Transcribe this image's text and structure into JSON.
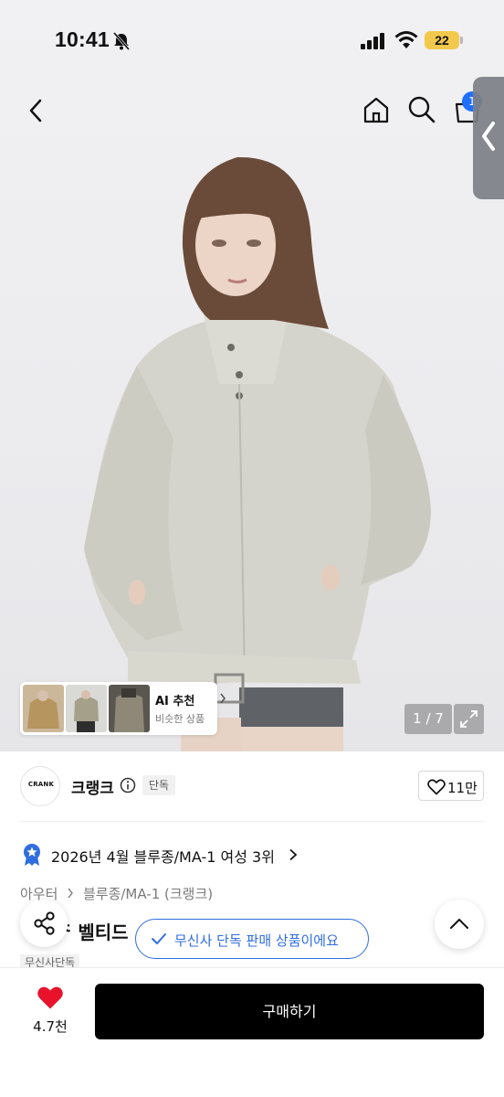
{
  "status_bar": {
    "time": "10:41",
    "battery": "22"
  },
  "nav": {
    "cart_badge": "1"
  },
  "gallery": {
    "ai_title": "AI 추천",
    "ai_subtitle": "비슷한 상품",
    "page_counter": "1 / 7"
  },
  "brand": {
    "logo_text": "CRANK",
    "name": "크랭크",
    "exclusive_tag": "단독",
    "like_count": "11만"
  },
  "ranking": {
    "text": "2026년 4월 블루종/MA-1 여성 3위"
  },
  "breadcrumb": {
    "category": "아우터",
    "subcategory": "블루종/MA-1 (크랭크)"
  },
  "product": {
    "title_partial": "ᄌ 벨티드",
    "store_tag": "무신사단독"
  },
  "notice": {
    "text": "무신사 단독 판매 상품이에요"
  },
  "bottom_bar": {
    "wish_count": "4.7천",
    "buy_label": "구매하기"
  },
  "colors": {
    "accent_blue": "#2f6ee0",
    "heart_red": "#e8132b",
    "battery_yellow": "#f2c94c",
    "buy_black": "#000000"
  },
  "icons": [
    "bell-off-icon",
    "signal-icon",
    "wifi-icon",
    "back-icon",
    "home-icon",
    "search-icon",
    "cart-icon",
    "info-icon",
    "heart-outline-icon",
    "medal-icon",
    "share-icon",
    "check-icon",
    "chevron-up-icon",
    "heart-icon",
    "expand-icon"
  ]
}
